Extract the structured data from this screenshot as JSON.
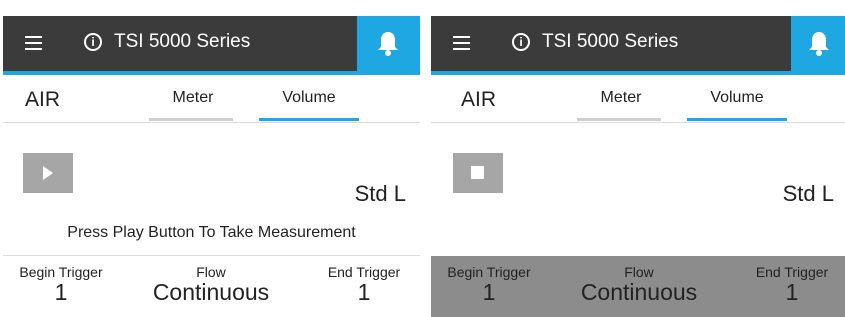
{
  "panels": [
    {
      "app_title": "TSI 5000 Series",
      "mode": "AIR",
      "tabs": [
        {
          "label": "Meter",
          "active": false
        },
        {
          "label": "Volume",
          "active": true
        }
      ],
      "action_button": "play",
      "unit": "Std L",
      "prompt": "Press Play Button To Take Measurement",
      "triggers": {
        "begin_label": "Begin Trigger",
        "begin_value": "1",
        "flow_label": "Flow",
        "flow_value": "Continuous",
        "end_label": "End Trigger",
        "end_value": "1"
      }
    },
    {
      "app_title": "TSI 5000 Series",
      "mode": "AIR",
      "tabs": [
        {
          "label": "Meter",
          "active": false
        },
        {
          "label": "Volume",
          "active": true
        }
      ],
      "action_button": "stop",
      "unit": "Std L",
      "triggers": {
        "begin_label": "Begin Trigger",
        "begin_value": "1",
        "flow_label": "Flow",
        "flow_value": "Continuous",
        "end_label": "End Trigger",
        "end_value": "1"
      }
    }
  ],
  "colors": {
    "appbar": "#3b3b3b",
    "accent": "#1ea7e1",
    "inactive_tab_line": "#cfcfcf",
    "button_gray": "#a6a6a6",
    "trigger_bar_active": "#8c8c8c"
  },
  "icons": [
    "menu-icon",
    "info-icon",
    "bell-icon",
    "play-icon",
    "stop-icon"
  ]
}
